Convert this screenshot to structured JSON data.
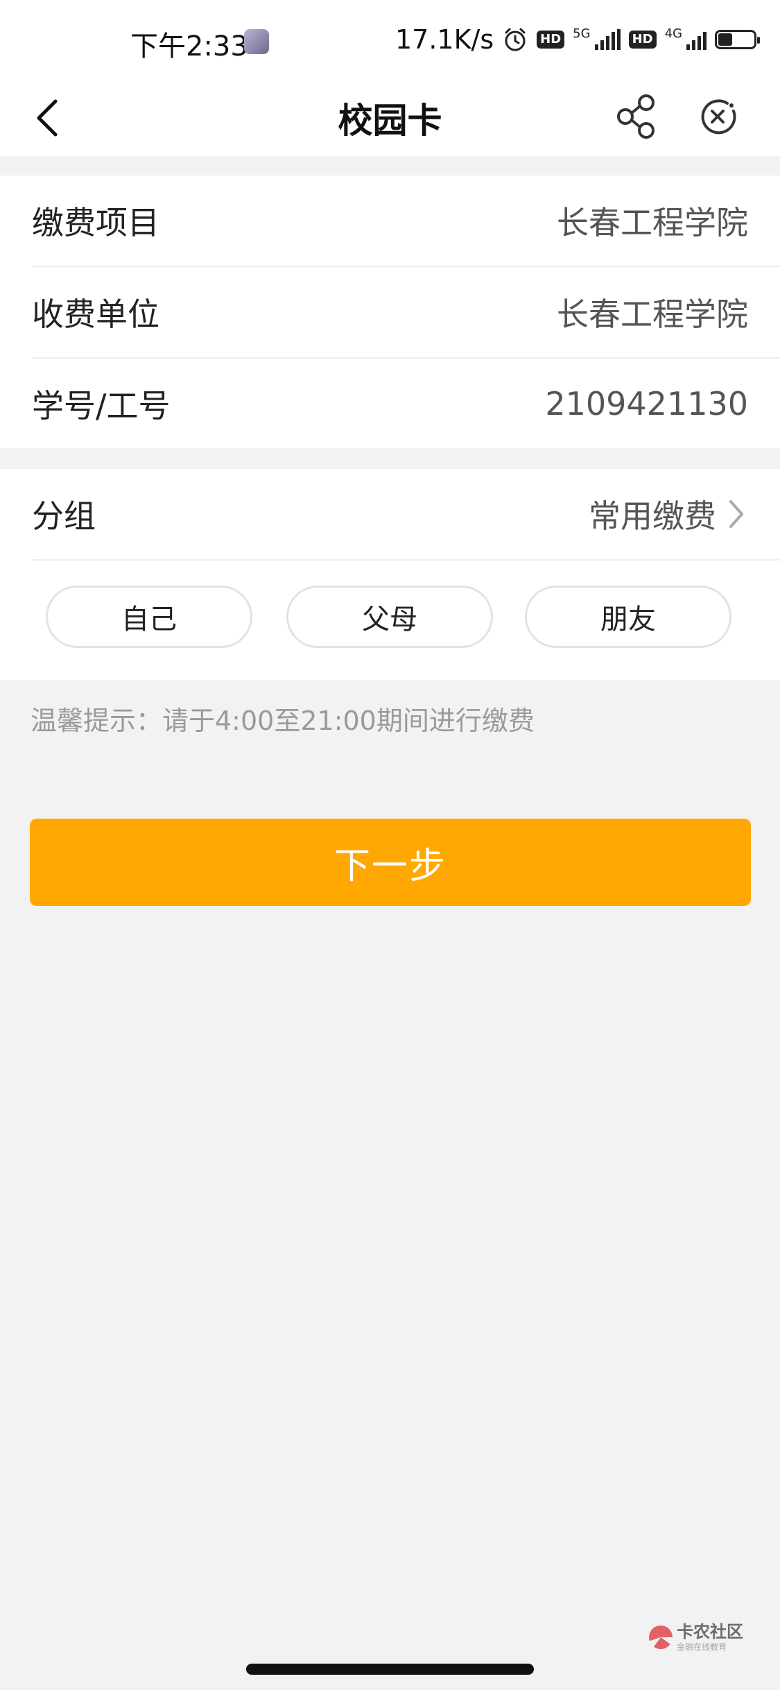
{
  "status_bar": {
    "time": "下午2:33",
    "net_speed": "17.1K/s",
    "hd_label": "HD",
    "network_1": "5G",
    "network_2": "4G"
  },
  "header": {
    "title": "校园卡",
    "back_icon": "chevron-left-icon",
    "share_icon": "share-icon",
    "close_icon": "close-circle-icon"
  },
  "payment_info": [
    {
      "label": "缴费项目",
      "value": "长春工程学院"
    },
    {
      "label": "收费单位",
      "value": "长春工程学院"
    },
    {
      "label": "学号/工号",
      "value": "2109421130"
    }
  ],
  "group": {
    "label": "分组",
    "value": "常用缴费",
    "chips": [
      "自己",
      "父母",
      "朋友"
    ]
  },
  "tip": "温馨提示：请于4:00至21:00期间进行缴费",
  "next_button": "下一步",
  "watermark": {
    "main": "卡农社区",
    "sub": "金融在线教育"
  },
  "colors": {
    "accent": "#ffa802",
    "background": "#f2f2f2",
    "card": "#ffffff"
  }
}
